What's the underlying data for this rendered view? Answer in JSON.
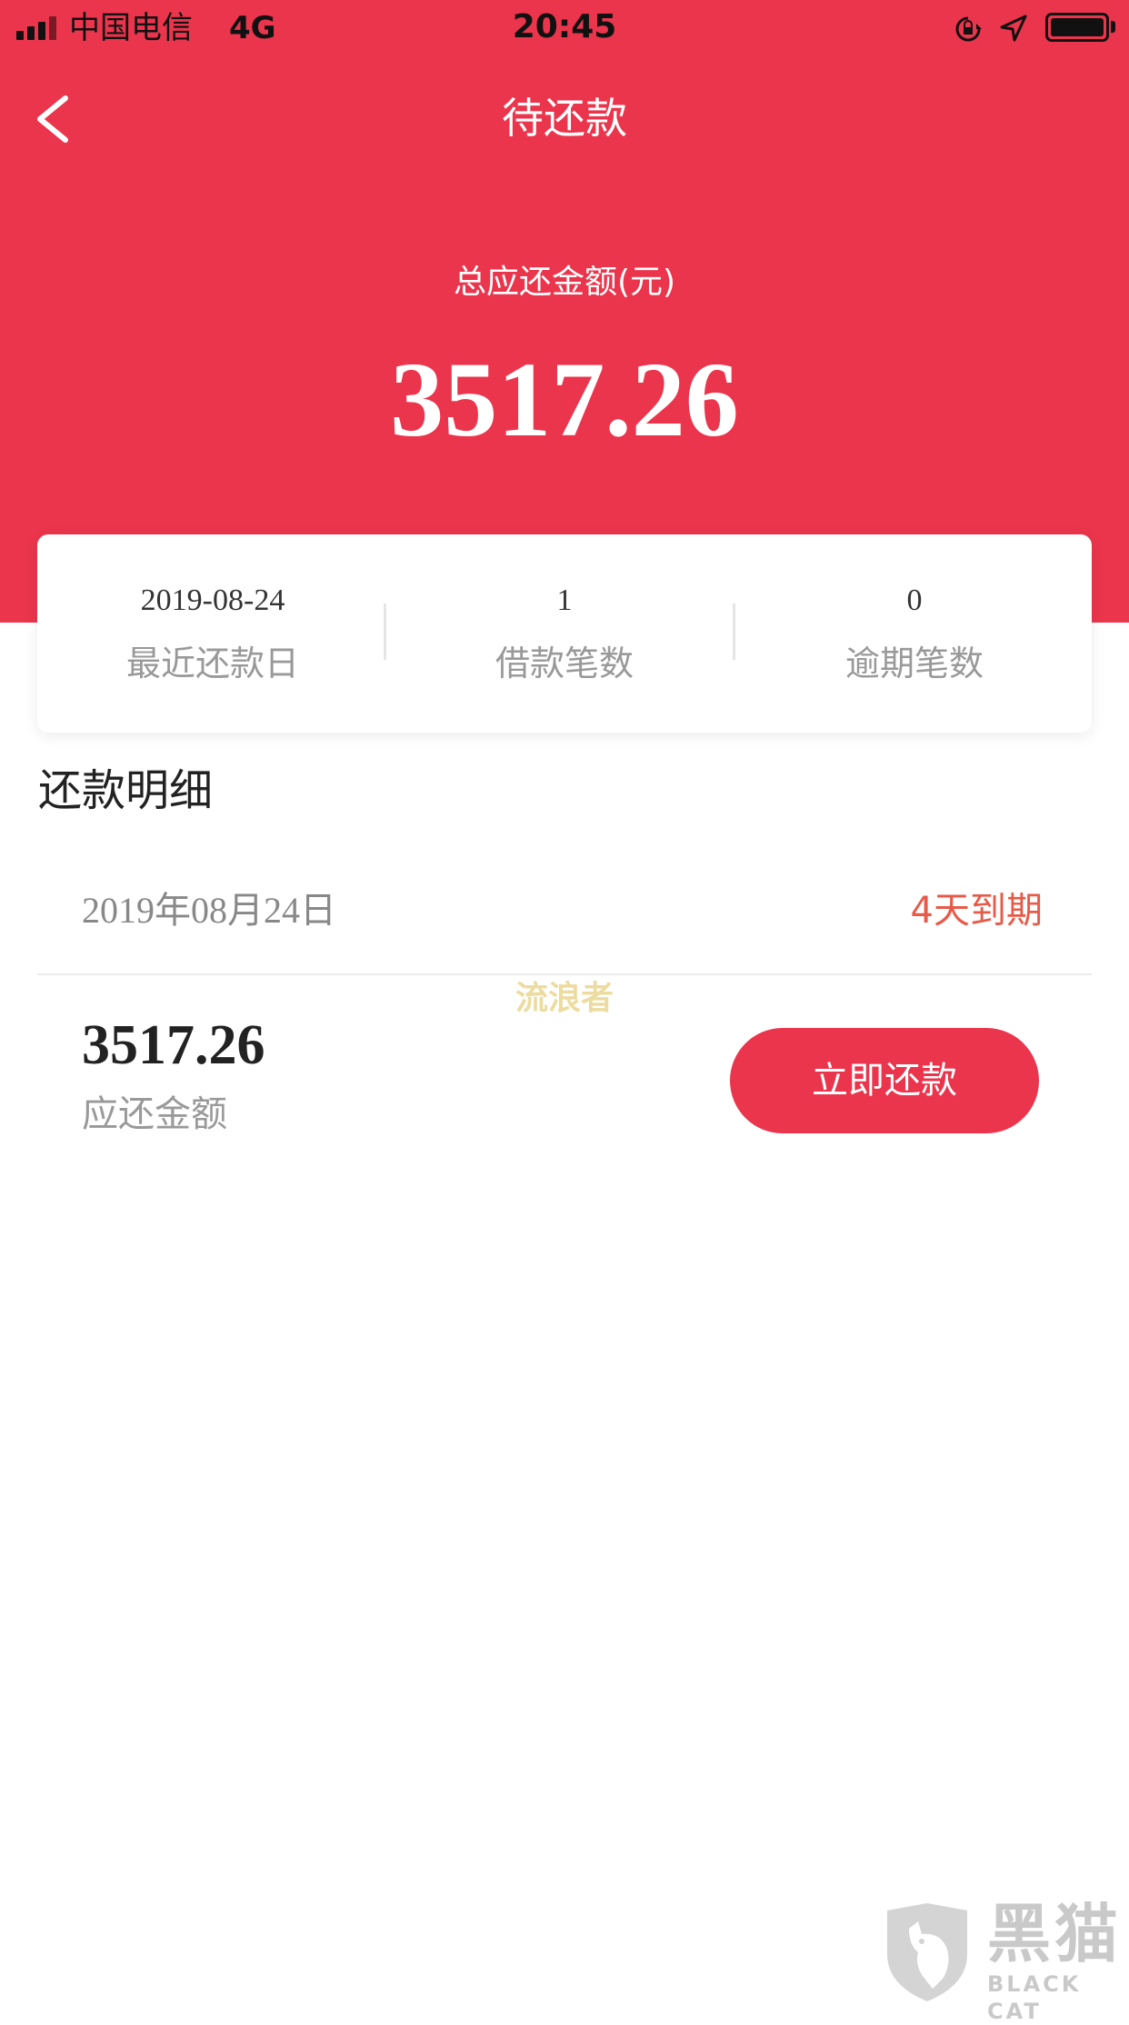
{
  "status_bar": {
    "carrier": "中国电信",
    "network": "4G",
    "time": "20:45",
    "icons": [
      "signal-icon",
      "rotation-lock-icon",
      "location-icon",
      "battery-icon"
    ]
  },
  "nav": {
    "title": "待还款",
    "back_icon": "chevron-left-icon"
  },
  "summary": {
    "total_label": "总应还金额(元)",
    "total_amount": "3517.26",
    "stats": [
      {
        "value": "2019-08-24",
        "label": "最近还款日"
      },
      {
        "value": "1",
        "label": "借款笔数"
      },
      {
        "value": "0",
        "label": "逾期笔数"
      }
    ]
  },
  "details": {
    "section_title": "还款明细",
    "items": [
      {
        "date": "2019年08月24日",
        "due_status": "4天到期",
        "amount": "3517.26",
        "amount_label": "应还金额",
        "button_label": "立即还款"
      }
    ]
  },
  "watermarks": {
    "center_text": "流浪者",
    "logo_name": "黑猫",
    "logo_sub": "BLACK CAT"
  },
  "colors": {
    "brand_red": "#ea354c",
    "due_orange": "#e85a47",
    "muted_text": "#999999"
  }
}
